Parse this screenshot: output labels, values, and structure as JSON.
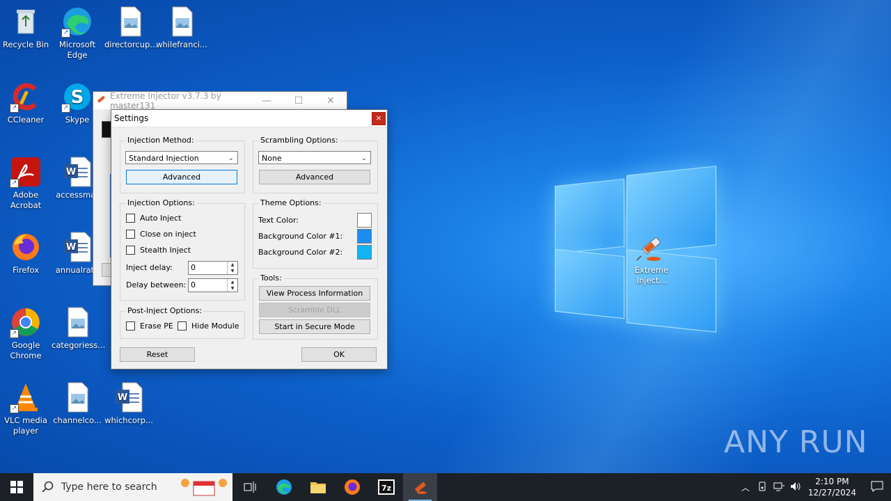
{
  "desktop_icons": [
    {
      "label": "Recycle Bin",
      "icon": "recycle-bin-icon"
    },
    {
      "label": "Microsoft Edge",
      "icon": "edge-icon"
    },
    {
      "label": "directorcup...",
      "icon": "image-file-icon"
    },
    {
      "label": "whilefranci...",
      "icon": "image-file-icon"
    },
    {
      "label": "CCleaner",
      "icon": "ccleaner-icon"
    },
    {
      "label": "Skype",
      "icon": "skype-icon"
    },
    {
      "label": "Adobe Acrobat",
      "icon": "acrobat-icon"
    },
    {
      "label": "accessmat",
      "icon": "word-doc-icon"
    },
    {
      "label": "Firefox",
      "icon": "firefox-icon"
    },
    {
      "label": "annualrate",
      "icon": "word-doc-icon"
    },
    {
      "label": "Google Chrome",
      "icon": "chrome-icon"
    },
    {
      "label": "categoriess...",
      "icon": "image-file-icon"
    },
    {
      "label": "VLC media player",
      "icon": "vlc-icon"
    },
    {
      "label": "channelco...",
      "icon": "image-file-icon"
    },
    {
      "label": "whichcorp...",
      "icon": "word-doc-icon"
    },
    {
      "label": "Extreme Inject...",
      "icon": "syringe-icon"
    }
  ],
  "bg_window": {
    "title": "Extreme Injector v3.7.3 by master131"
  },
  "settings": {
    "title": "Settings",
    "close": "×",
    "injection_method": {
      "label": "Injection Method:",
      "value": "Standard Injection",
      "advanced": "Advanced"
    },
    "scrambling": {
      "label": "Scrambling Options:",
      "value": "None",
      "advanced": "Advanced"
    },
    "injection_options": {
      "label": "Injection Options:",
      "auto": "Auto Inject",
      "close": "Close on inject",
      "stealth": "Stealth Inject",
      "delay_label": "Inject delay:",
      "delay_value": "0",
      "between_label": "Delay between:",
      "between_value": "0"
    },
    "theme": {
      "label": "Theme Options:",
      "text_color": "Text Color:",
      "bg1": "Background Color #1:",
      "bg2": "Background Color #2:",
      "text_hex": "#ffffff",
      "bg1_hex": "#1e8cf0",
      "bg2_hex": "#12b4f5"
    },
    "tools": {
      "label": "Tools:",
      "view": "View Process Information",
      "scramble": "Scramble DLL",
      "secure": "Start in Secure Mode"
    },
    "post_inject": {
      "label": "Post-Inject Options:",
      "erase": "Erase PE",
      "hide": "Hide Module"
    },
    "reset": "Reset",
    "ok": "OK"
  },
  "taskbar": {
    "search_placeholder": "Type here to search",
    "time": "2:10 PM",
    "date": "12/27/2024"
  },
  "watermark": "ANY RUN"
}
